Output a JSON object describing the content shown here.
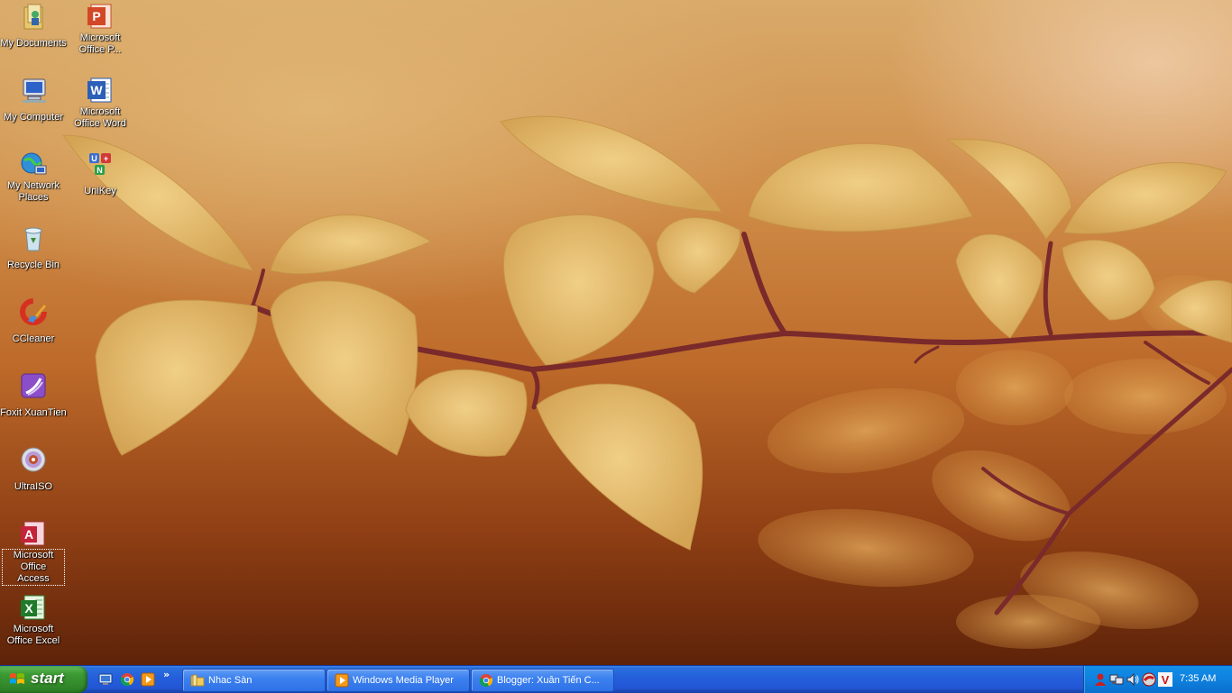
{
  "desktop": {
    "icons": [
      {
        "label": "My Documents",
        "icon": "my-documents-icon"
      },
      {
        "label": "Microsoft Office P...",
        "icon": "powerpoint-icon"
      },
      {
        "label": "My Computer",
        "icon": "my-computer-icon"
      },
      {
        "label": "Microsoft Office Word",
        "icon": "word-icon"
      },
      {
        "label": "My Network Places",
        "icon": "network-places-icon"
      },
      {
        "label": "UniKey",
        "icon": "unikey-icon"
      },
      {
        "label": "Recycle Bin",
        "icon": "recycle-bin-icon"
      },
      {
        "label": "CCleaner",
        "icon": "ccleaner-icon"
      },
      {
        "label": "Foxit XuanTien",
        "icon": "foxit-icon"
      },
      {
        "label": "UltraISO",
        "icon": "ultraiso-icon"
      },
      {
        "label": "Microsoft Office Access",
        "icon": "access-icon"
      },
      {
        "label": "Microsoft Office Excel",
        "icon": "excel-icon"
      }
    ],
    "selected_icon": "Microsoft Office Access"
  },
  "taskbar": {
    "start_label": "start",
    "quick_launch": [
      "show-desktop-icon",
      "chrome-icon",
      "media-player-icon"
    ],
    "more_glyph": "»",
    "tasks": [
      {
        "label": "Nhac Sàn",
        "icon": "folder-icon"
      },
      {
        "label": "Windows Media Player",
        "icon": "media-player-icon"
      },
      {
        "label": "Blogger: Xuân Tiến C...",
        "icon": "chrome-icon"
      }
    ],
    "tray": {
      "icons": [
        "user-tray-icon",
        "network-tray-icon",
        "volume-icon",
        "antivirus-icon",
        "vietnamese-input-icon"
      ],
      "clock": "7:35 AM"
    },
    "colors": {
      "bar": "#245edb",
      "start": "#3c9a34",
      "tray": "#0f84e0"
    }
  }
}
